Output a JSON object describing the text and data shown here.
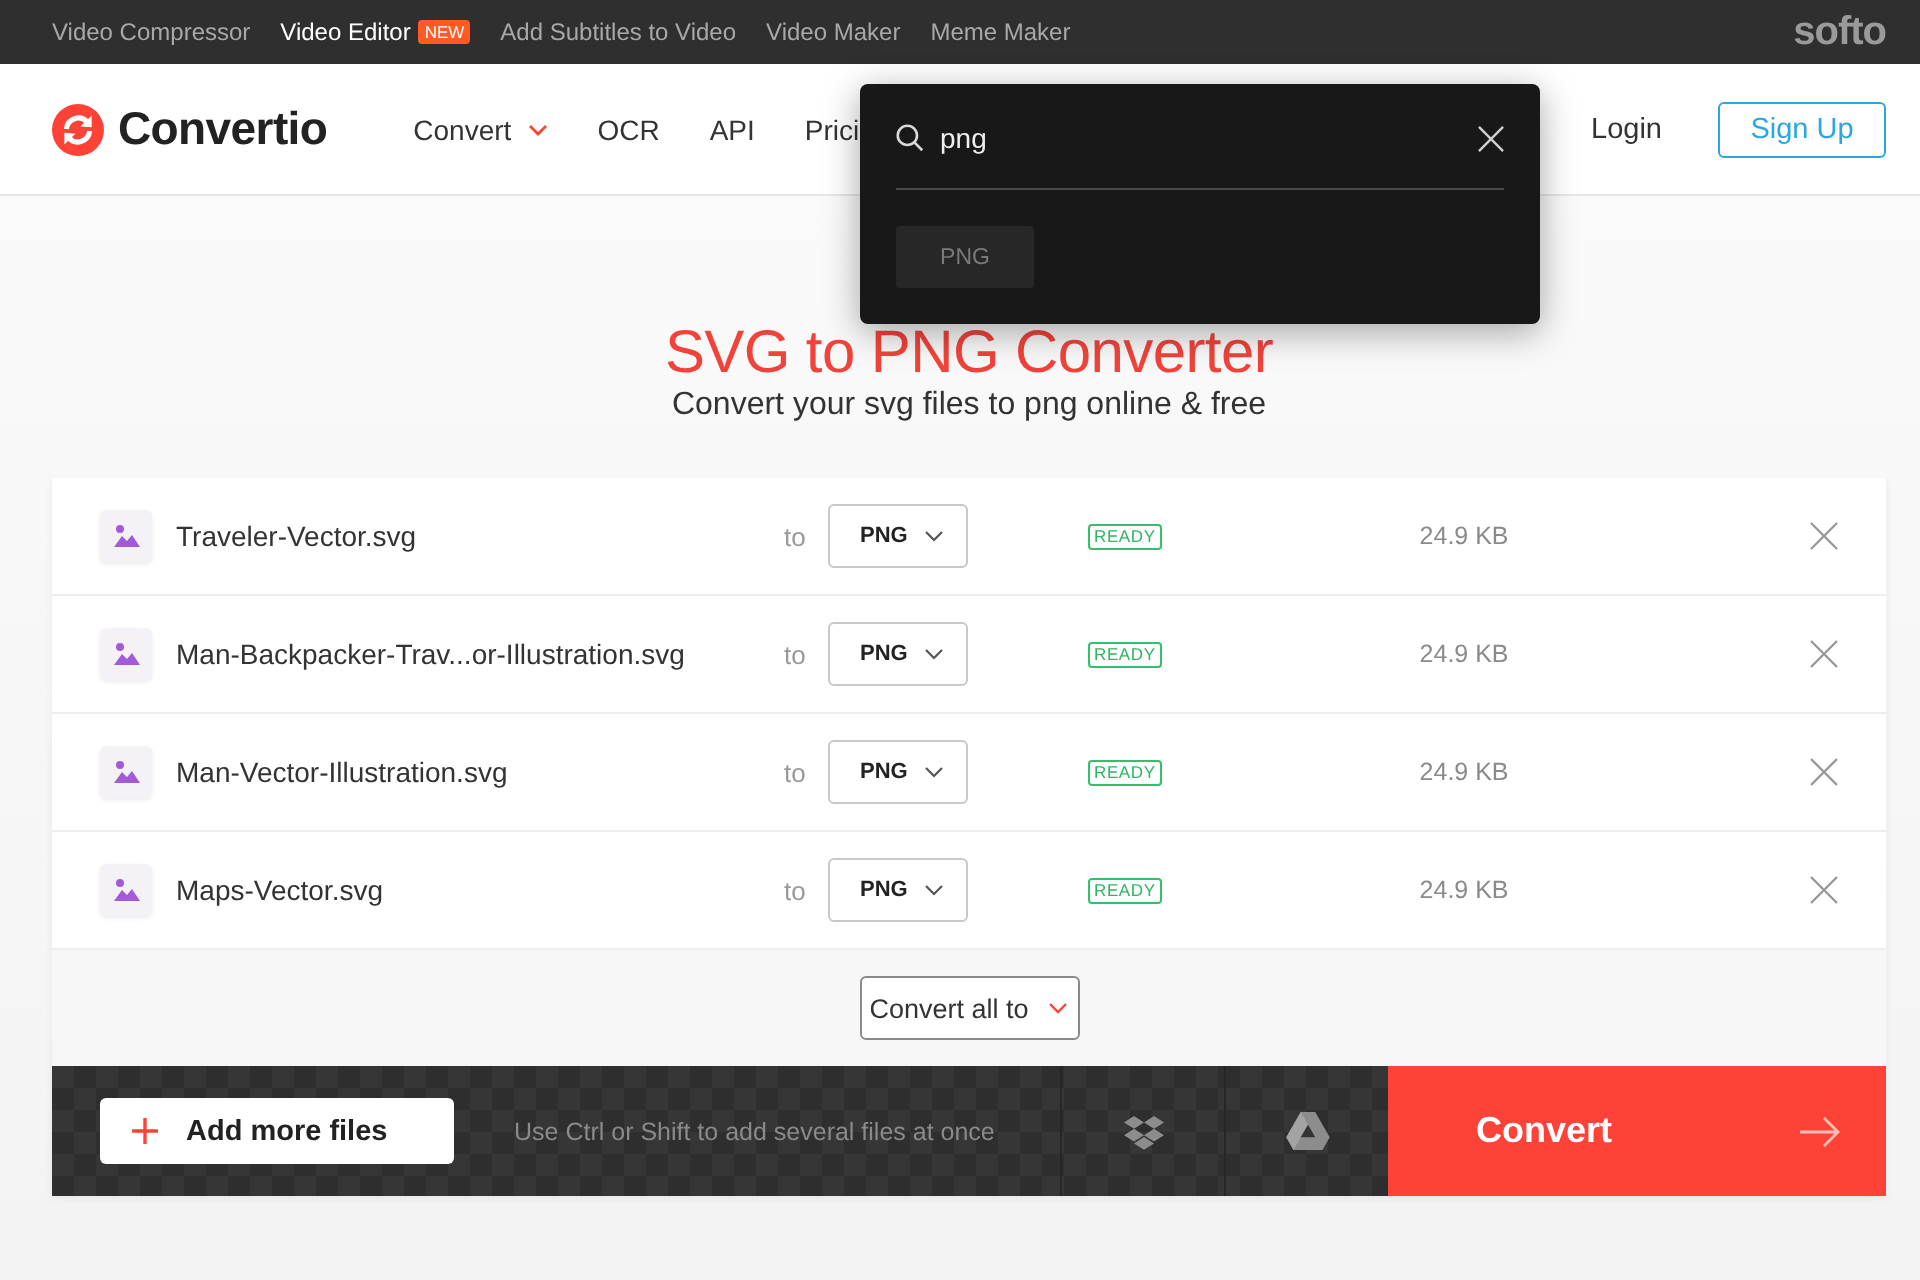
{
  "top_bar": {
    "links": [
      {
        "label": "Video Compressor",
        "selected": false
      },
      {
        "label": "Video Editor",
        "selected": true,
        "badge": "NEW"
      },
      {
        "label": "Add Subtitles to Video",
        "selected": false
      },
      {
        "label": "Video Maker",
        "selected": false
      },
      {
        "label": "Meme Maker",
        "selected": false
      }
    ],
    "brand": "softo"
  },
  "header": {
    "logo": "Convertio",
    "nav": [
      {
        "label": "Convert",
        "kind": "dropdown"
      },
      {
        "label": "OCR",
        "kind": "link"
      },
      {
        "label": "API",
        "kind": "link"
      },
      {
        "label": "Prici",
        "kind": "link"
      }
    ],
    "login": "Login",
    "signup": "Sign Up"
  },
  "search_popup": {
    "value": "png",
    "results": [
      "PNG"
    ]
  },
  "hero": {
    "title": "SVG to PNG Converter",
    "subtitle": "Convert your svg files to png online & free"
  },
  "files": [
    {
      "name": "Traveler-Vector.svg",
      "to_label": "to",
      "format": "PNG",
      "status": "READY",
      "size": "24.9 KB"
    },
    {
      "name": "Man-Backpacker-Trav...or-Illustration.svg",
      "to_label": "to",
      "format": "PNG",
      "status": "READY",
      "size": "24.9 KB"
    },
    {
      "name": "Man-Vector-Illustration.svg",
      "to_label": "to",
      "format": "PNG",
      "status": "READY",
      "size": "24.9 KB"
    },
    {
      "name": "Maps-Vector.svg",
      "to_label": "to",
      "format": "PNG",
      "status": "READY",
      "size": "24.9 KB"
    }
  ],
  "convert_all": "Convert all to",
  "action_bar": {
    "add_button": "Add more files",
    "hint": "Use Ctrl or Shift to add several files at once",
    "convert_button": "Convert"
  }
}
